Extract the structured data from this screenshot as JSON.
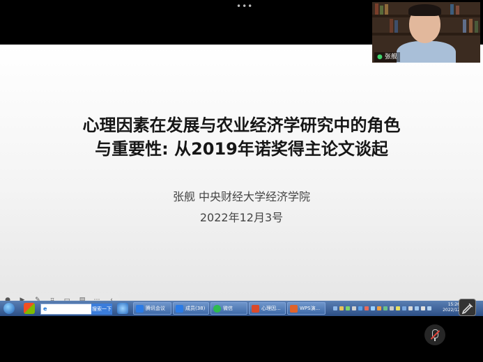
{
  "slide": {
    "title_line1": "心理因素在发展与农业经济学研究中的角色",
    "title_line2": "与重要性: 从2019年诺奖得主论文谈起",
    "author_line": "张舰  中央财经大学经济学院",
    "date": "2022年12月3号"
  },
  "participant": {
    "name": "张舰"
  },
  "taskbar": {
    "search_placeholder": "",
    "search_button": "搜索一下",
    "tasks": [
      {
        "label": "腾讯会议",
        "color": "#2b7be6"
      },
      {
        "label": "成员(38)",
        "color": "#2b7be6"
      },
      {
        "label": "微信",
        "color": "#2dbb4e"
      },
      {
        "label": "心理因...",
        "color": "#d94a2b"
      },
      {
        "label": "WPS演...",
        "color": "#e0632b"
      }
    ],
    "clock_time": "15:26",
    "clock_date": "2022/12"
  },
  "colors": {
    "slide_title": "#161616",
    "mic_on": "#3ed36b",
    "mic_muted_slash": "#e0443a"
  }
}
